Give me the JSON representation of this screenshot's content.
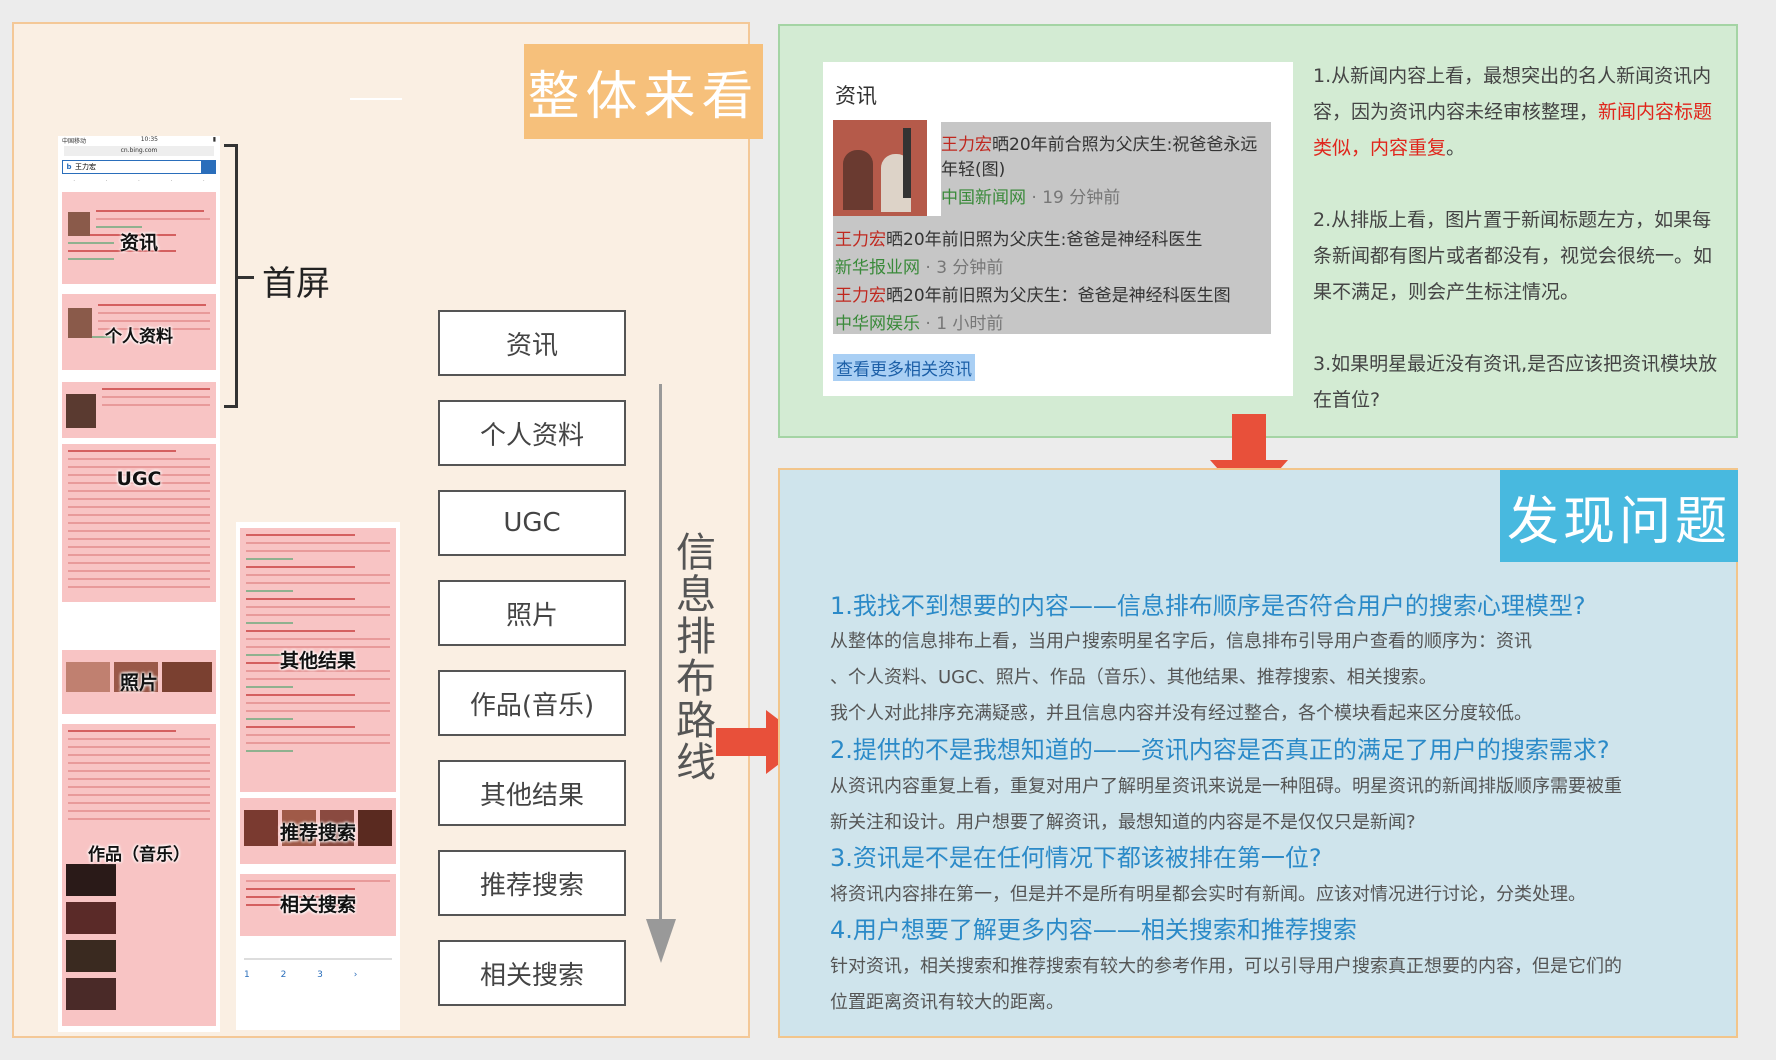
{
  "left": {
    "title": "整体来看",
    "first_screen": "首屏",
    "route_label": "信息排布路线",
    "phone": {
      "carrier": "中国移动",
      "time": "10:35",
      "url": "cn.bing.com",
      "query": "王力宏"
    },
    "block_labels": [
      "资讯",
      "个人资料",
      "UGC",
      "照片",
      "作品（音乐）",
      "其他结果",
      "推荐搜索",
      "相关搜索"
    ],
    "flow": [
      "资讯",
      "个人资料",
      "UGC",
      "照片",
      "作品(音乐)",
      "其他结果",
      "推荐搜索",
      "相关搜索"
    ]
  },
  "news_card": {
    "heading": "资讯",
    "items": [
      {
        "title_red": "王力宏",
        "title_rest": "晒20年前合照为父庆生:祝爸爸永远",
        "title_rest2": "年轻(图)",
        "source": "中国新闻网",
        "time": " · 19 分钟前"
      },
      {
        "title_red": "王力宏",
        "title_rest": "晒20年前旧照为父庆生:爸爸是神经科医生",
        "source": "新华报业网",
        "time": " · 3 分钟前"
      },
      {
        "title_red": "王力宏",
        "title_rest": "晒20年前旧照为父庆生：爸爸是神经科医生图",
        "source": "中华网娱乐",
        "time": " · 1 小时前"
      }
    ],
    "more": "查看更多相关资讯"
  },
  "notes": {
    "p1_a": "1.从新闻内容上看，最想突出的名人新闻资讯内容，因为资讯内容未经审核整理，",
    "p1_hl": "新闻内容标题类似，内容重复",
    "p1_b": "。",
    "p2": "2.从排版上看，图片置于新闻标题左方，如果每条新闻都有图片或者都没有，视觉会很统一。如果不满足，则会产生标注情况。",
    "p3": "3.如果明星最近没有资讯,是否应该把资讯模块放在首位?"
  },
  "problems": {
    "title": "发现问题",
    "q1": "1.我找不到想要的内容——信息排布顺序是否符合用户的搜索心理模型?",
    "d1a": "从整体的信息排布上看，当用户搜索明星名字后，信息排布引导用户查看的顺序为：资讯",
    "d1b": "、个人资料、UGC、照片、作品（音乐）、其他结果、推荐搜索、相关搜索。",
    "d1c": "我个人对此排序充满疑惑，并且信息内容并没有经过整合，各个模块看起来区分度较低。",
    "q2": "2.提供的不是我想知道的——资讯内容是否真正的满足了用户的搜索需求?",
    "d2a": "从资讯内容重复上看，重复对用户了解明星资讯来说是一种阻碍。明星资讯的新闻排版顺序需要被重",
    "d2b": "新关注和设计。用户想要了解资讯，最想知道的内容是不是仅仅只是新闻?",
    "q3": "3.资讯是不是在任何情况下都该被排在第一位?",
    "d3": "将资讯内容排在第一，但是并不是所有明星都会实时有新闻。应该对情况进行讨论，分类处理。",
    "q4": "4.用户想要了解更多内容——相关搜索和推荐搜索",
    "d4a": "针对资讯，相关搜索和推荐搜索有较大的参考作用，可以引导用户搜索真正想要的内容，但是它们的",
    "d4b": "位置距离资讯有较大的距离。"
  },
  "colors": {
    "left_bg": "#faefe3",
    "left_title_bg": "#f6c07b",
    "green_bg": "#d3ebd3",
    "blue_bg": "#cfe4ec",
    "problem_title_bg": "#48b9df",
    "question_text": "#2b8ac8",
    "highlight_red": "#e0261c",
    "arrow_red": "#e8503a"
  }
}
